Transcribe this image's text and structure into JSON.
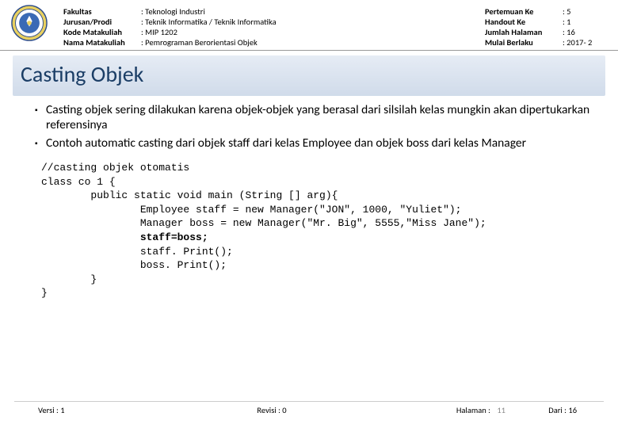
{
  "header": {
    "labels1": {
      "fakultas": "Fakultas",
      "jurusan": "Jurusan/Prodi",
      "kode": "Kode Matakuliah",
      "nama": "Nama Matakuliah"
    },
    "values1": {
      "fakultas": ": Teknologi Industri",
      "jurusan": ": Teknik Informatika / Teknik Informatika",
      "kode": ": MIP 1202",
      "nama": ": Pemrograman Berorientasi Objek"
    },
    "labels2": {
      "pertemuan": "Pertemuan Ke",
      "handout": "Handout Ke",
      "jumlah": "Jumlah Halaman",
      "mulai": "Mulai Berlaku"
    },
    "values2": {
      "pertemuan": ": 5",
      "handout": ": 1",
      "jumlah": ": 16",
      "mulai": ": 2017- 2"
    }
  },
  "title": "Casting Objek",
  "bullets": {
    "b1": "Casting objek sering dilakukan karena objek-objek yang berasal dari silsilah kelas mungkin akan dipertukarkan referensinya",
    "b2": "Contoh automatic casting dari objek staff dari kelas Employee dan objek boss dari kelas Manager"
  },
  "code": {
    "l1": "//casting objek otomatis",
    "l2": "class co 1 {",
    "l3": "        public static void main (String [] arg){",
    "l4": "                Employee staff = new Manager(\"JON\", 1000, \"Yuliet\");",
    "l5": "                Manager boss = new Manager(\"Mr. Big\", 5555,\"Miss Jane\");",
    "l6": "                staff=boss;",
    "l7": "                staff. Print();",
    "l8": "                boss. Print();",
    "l9": "        }",
    "l10": "}"
  },
  "footer": {
    "versi": "Versi : 1",
    "revisi": "Revisi : 0",
    "halaman_label": "Halaman :",
    "halaman_num": "11",
    "dari": "Dari : 16"
  }
}
